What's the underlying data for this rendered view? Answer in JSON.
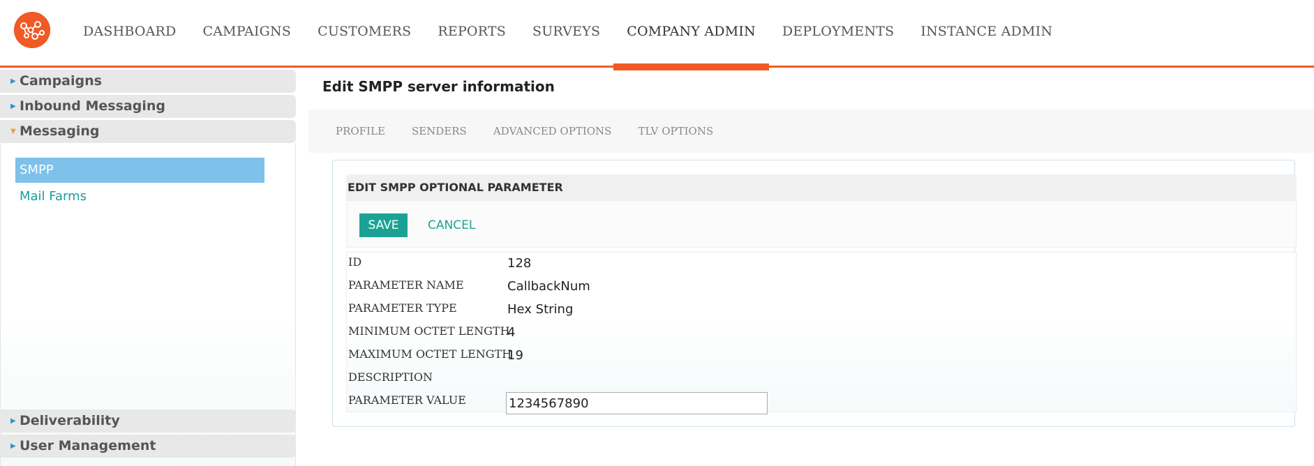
{
  "nav": {
    "items": [
      "DASHBOARD",
      "CAMPAIGNS",
      "CUSTOMERS",
      "REPORTS",
      "SURVEYS",
      "COMPANY ADMIN",
      "DEPLOYMENTS",
      "INSTANCE ADMIN"
    ],
    "active": "COMPANY ADMIN"
  },
  "sidebar": {
    "sections": [
      {
        "label": "Campaigns",
        "expanded": false
      },
      {
        "label": "Inbound Messaging",
        "expanded": false
      },
      {
        "label": "Messaging",
        "expanded": true
      },
      {
        "label": "Deliverability",
        "expanded": false
      },
      {
        "label": "User Management",
        "expanded": false
      }
    ],
    "links": [
      {
        "label": "SMPP",
        "active": true
      },
      {
        "label": "Mail Farms",
        "active": false
      }
    ]
  },
  "page": {
    "title": "Edit SMPP server information",
    "tabs": [
      "PROFILE",
      "SENDERS",
      "ADVANCED OPTIONS",
      "TLV OPTIONS"
    ]
  },
  "panel": {
    "heading": "EDIT SMPP OPTIONAL PARAMETER",
    "save_label": "SAVE",
    "cancel_label": "CANCEL",
    "fields": [
      {
        "label": "ID",
        "value": "128"
      },
      {
        "label": "PARAMETER NAME",
        "value": "CallbackNum"
      },
      {
        "label": "PARAMETER TYPE",
        "value": "Hex String"
      },
      {
        "label": "MINIMUM OCTET LENGTH",
        "value": "4"
      },
      {
        "label": "MAXIMUM OCTET LENGTH",
        "value": "19"
      },
      {
        "label": "DESCRIPTION",
        "value": ""
      }
    ],
    "param_value": {
      "label": "PARAMETER VALUE",
      "value": "1234567890"
    }
  },
  "colors": {
    "brand": "#f15a24",
    "accent": "#1aa394",
    "active_link_bg": "#7ec1ea"
  }
}
